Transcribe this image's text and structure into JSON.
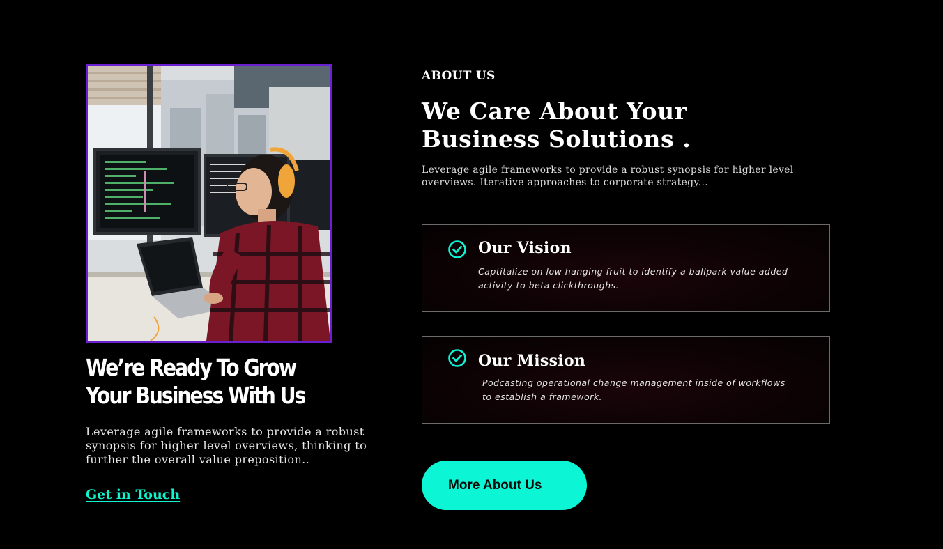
{
  "left": {
    "heading": "We’re Ready To Grow Your Business With Us",
    "description": "Leverage agile frameworks to provide a robust synopsis for higher level overviews, thinking to further the overall value preposition..",
    "cta_label": "Get in Touch"
  },
  "right": {
    "eyebrow": "ABOUT US",
    "title": "We Care About Your Business Solutions .",
    "description": "Leverage agile frameworks to provide a robust synopsis for higher level overviews. Iterative approaches to corporate strategy...",
    "cards": [
      {
        "title": "Our Vision",
        "text": "Captitalize on low hanging fruit to identify a ballpark value added activity to beta clickthroughs.",
        "icon": "check-circle-icon"
      },
      {
        "title": "Our Mission",
        "text": "Podcasting operational change management inside of workflows to establish a framework.",
        "icon": "check-circle-icon"
      }
    ],
    "button_label": "More About Us"
  },
  "colors": {
    "background": "#000000",
    "accent": "#0cf5d4",
    "image_border": "#6a1fd1",
    "card_border": "#6b6b6b"
  }
}
